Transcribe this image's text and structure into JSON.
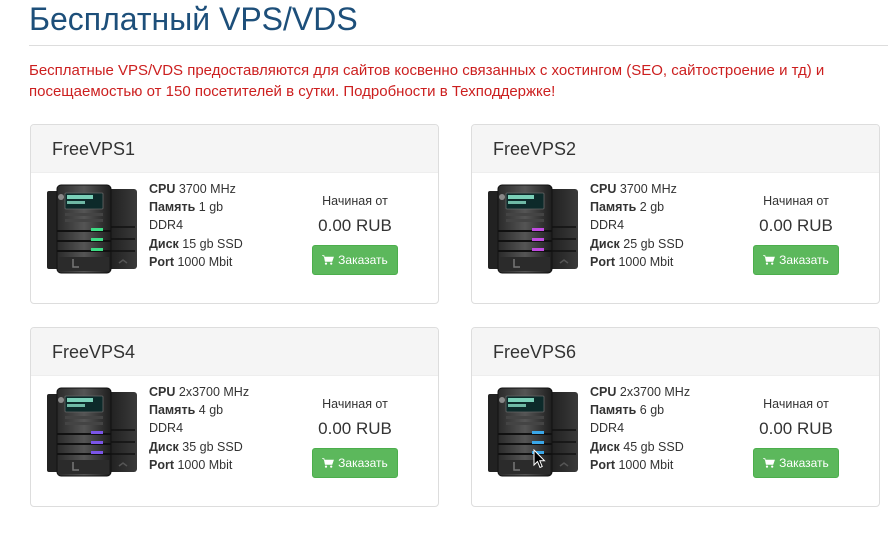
{
  "page": {
    "title": "Бесплатный VPS/VDS",
    "notice": "Бесплатные VPS/VDS предоставляются для сайтов косвенно связанных с хостингом (SEO, сайтостроение и тд) и посещаемостью от 150 посетителей в сутки. Подробности в Техподдержке!"
  },
  "colors": {
    "title": "#1d4f7a",
    "notice": "#cc1f1f",
    "button": "#5cb85c"
  },
  "plans": [
    {
      "name": "FreeVPS1",
      "cpu_label": "CPU",
      "cpu": "3700 MHz",
      "ram_label": "Память",
      "ram": "1 gb",
      "ram_type": "DDR4",
      "disk_label": "Диск",
      "disk": "15 gb SSD",
      "port_label": "Port",
      "port": "1000 Mbit",
      "price_label": "Начиная от",
      "price": "0.00 RUB",
      "order_label": "Заказать",
      "led_color": "#3ddc84"
    },
    {
      "name": "FreeVPS2",
      "cpu_label": "CPU",
      "cpu": "3700 MHz",
      "ram_label": "Память",
      "ram": "2 gb",
      "ram_type": "DDR4",
      "disk_label": "Диск",
      "disk": "25 gb SSD",
      "port_label": "Port",
      "port": "1000 Mbit",
      "price_label": "Начиная от",
      "price": "0.00 RUB",
      "order_label": "Заказать",
      "led_color": "#c04be0"
    },
    {
      "name": "FreeVPS4",
      "cpu_label": "CPU",
      "cpu": "2x3700 MHz",
      "ram_label": "Память",
      "ram": "4 gb",
      "ram_type": "DDR4",
      "disk_label": "Диск",
      "disk": "35 gb SSD",
      "port_label": "Port",
      "port": "1000 Mbit",
      "price_label": "Начиная от",
      "price": "0.00 RUB",
      "order_label": "Заказать",
      "led_color": "#7b55e8"
    },
    {
      "name": "FreeVPS6",
      "cpu_label": "CPU",
      "cpu": "2x3700 MHz",
      "ram_label": "Память",
      "ram": "6 gb",
      "ram_type": "DDR4",
      "disk_label": "Диск",
      "disk": "45 gb SSD",
      "port_label": "Port",
      "port": "1000 Mbit",
      "price_label": "Начиная от",
      "price": "0.00 RUB",
      "order_label": "Заказать",
      "led_color": "#3aa7e8"
    }
  ]
}
